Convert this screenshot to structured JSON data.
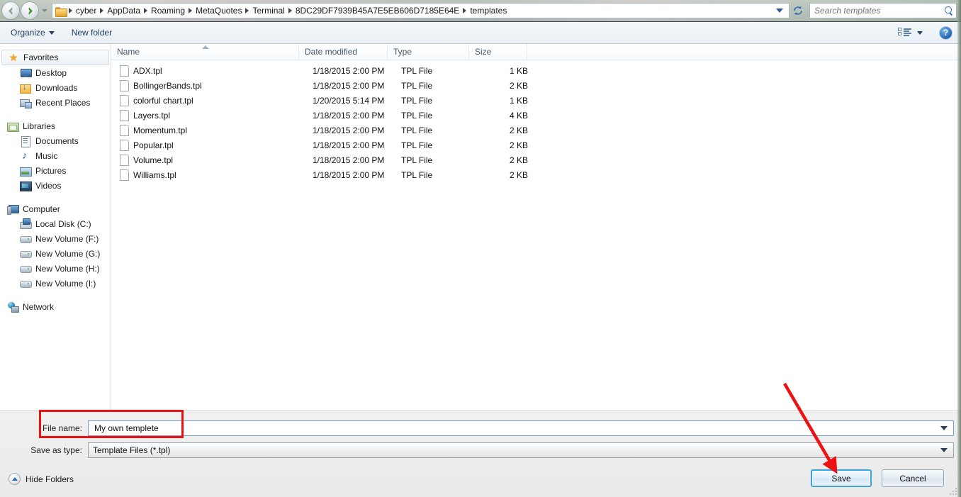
{
  "titlebar": {
    "back_label": "Back",
    "forward_label": "Forward",
    "history_label": "Recent pages",
    "breadcrumbs": [
      "cyber",
      "AppData",
      "Roaming",
      "MetaQuotes",
      "Terminal",
      "8DC29DF7939B45A7E5EB606D7185E64E",
      "templates"
    ],
    "refresh_label": "↻",
    "search_placeholder": "Search templates",
    "search_value": ""
  },
  "toolbar": {
    "organize_label": "Organize",
    "new_folder_label": "New folder",
    "view_label": "Change your view",
    "help_label": "?"
  },
  "sidebar": {
    "groups": [
      {
        "header": {
          "label": "Favorites",
          "icon": "star-icon",
          "selected": true
        },
        "items": [
          {
            "label": "Desktop",
            "icon": "desktop-icon"
          },
          {
            "label": "Downloads",
            "icon": "downloads-icon"
          },
          {
            "label": "Recent Places",
            "icon": "recent-places-icon"
          }
        ]
      },
      {
        "header": {
          "label": "Libraries",
          "icon": "libraries-icon",
          "selected": false
        },
        "items": [
          {
            "label": "Documents",
            "icon": "documents-icon"
          },
          {
            "label": "Music",
            "icon": "music-icon"
          },
          {
            "label": "Pictures",
            "icon": "pictures-icon"
          },
          {
            "label": "Videos",
            "icon": "videos-icon"
          }
        ]
      },
      {
        "header": {
          "label": "Computer",
          "icon": "computer-icon",
          "selected": false
        },
        "items": [
          {
            "label": "Local Disk (C:)",
            "icon": "local-disk-icon"
          },
          {
            "label": "New Volume (F:)",
            "icon": "drive-icon"
          },
          {
            "label": "New Volume (G:)",
            "icon": "drive-icon"
          },
          {
            "label": "New Volume (H:)",
            "icon": "drive-icon"
          },
          {
            "label": "New Volume (I:)",
            "icon": "drive-icon"
          }
        ]
      },
      {
        "header": {
          "label": "Network",
          "icon": "network-icon",
          "selected": false
        },
        "items": []
      }
    ]
  },
  "filelist": {
    "columns": [
      "Name",
      "Date modified",
      "Type",
      "Size"
    ],
    "sort_column": "Name",
    "sort_direction": "ascending",
    "rows": [
      {
        "name": "ADX.tpl",
        "date": "1/18/2015 2:00 PM",
        "type": "TPL File",
        "size": "1 KB"
      },
      {
        "name": "BollingerBands.tpl",
        "date": "1/18/2015 2:00 PM",
        "type": "TPL File",
        "size": "2 KB"
      },
      {
        "name": "colorful chart.tpl",
        "date": "1/20/2015 5:14 PM",
        "type": "TPL File",
        "size": "1 KB"
      },
      {
        "name": "Layers.tpl",
        "date": "1/18/2015 2:00 PM",
        "type": "TPL File",
        "size": "4 KB"
      },
      {
        "name": "Momentum.tpl",
        "date": "1/18/2015 2:00 PM",
        "type": "TPL File",
        "size": "2 KB"
      },
      {
        "name": "Popular.tpl",
        "date": "1/18/2015 2:00 PM",
        "type": "TPL File",
        "size": "2 KB"
      },
      {
        "name": "Volume.tpl",
        "date": "1/18/2015 2:00 PM",
        "type": "TPL File",
        "size": "2 KB"
      },
      {
        "name": "Williams.tpl",
        "date": "1/18/2015 2:00 PM",
        "type": "TPL File",
        "size": "2 KB"
      }
    ]
  },
  "form": {
    "filename_label": "File name:",
    "filename_value": "My own templete",
    "savetype_label": "Save as type:",
    "savetype_value": "Template Files (*.tpl)"
  },
  "footer": {
    "hide_folders_label": "Hide Folders",
    "save_label": "Save",
    "cancel_label": "Cancel"
  },
  "annotations": {
    "highlight_color": "#ee1111",
    "arrow_color": "#ee1111",
    "highlight_target": "File name field",
    "arrow_target": "Save button"
  }
}
